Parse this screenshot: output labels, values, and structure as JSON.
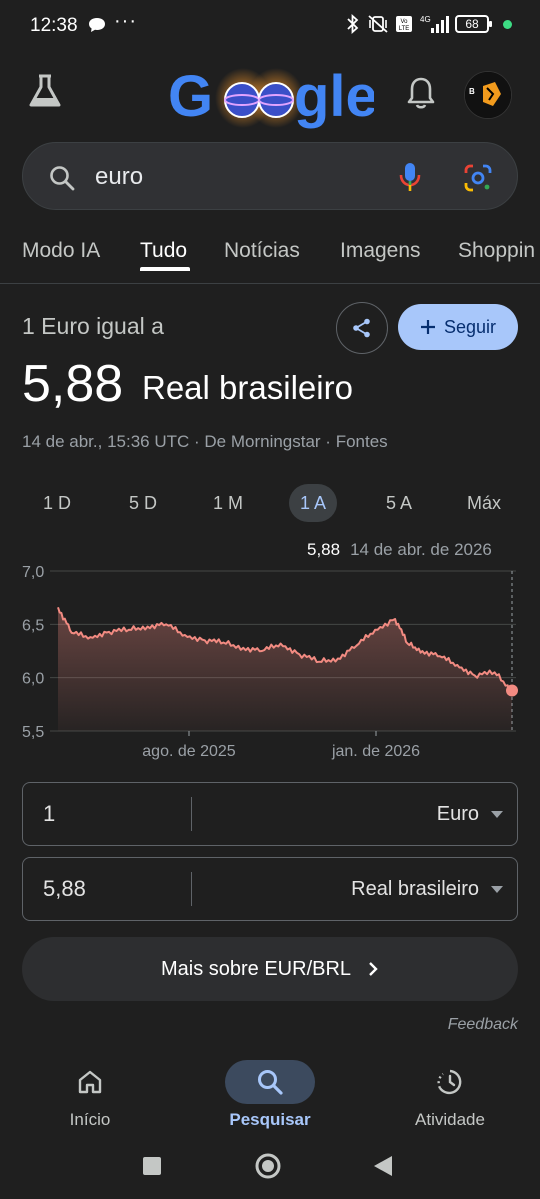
{
  "status_bar": {
    "time": "12:38",
    "battery": "68",
    "network": "4G"
  },
  "header": {
    "logo_text": "Google"
  },
  "search": {
    "query": "euro"
  },
  "tabs": [
    {
      "label": "Modo IA"
    },
    {
      "label": "Tudo"
    },
    {
      "label": "Notícias"
    },
    {
      "label": "Imagens"
    },
    {
      "label": "Shoppin"
    }
  ],
  "conversion": {
    "label": "1 Euro igual a",
    "rate": "5,88",
    "target_currency": "Real brasileiro",
    "meta": "14 de abr., 15:36 UTC · De Morningstar · Fontes",
    "follow_label": "Seguir"
  },
  "ranges": [
    {
      "label": "1 D"
    },
    {
      "label": "5 D"
    },
    {
      "label": "1 M"
    },
    {
      "label": "1 A",
      "active": true
    },
    {
      "label": "5 A"
    },
    {
      "label": "Máx"
    }
  ],
  "tooltip": {
    "value": "5,88",
    "date": "14 de abr. de 2026"
  },
  "chart_data": {
    "type": "area",
    "title": "",
    "xlabel": "",
    "ylabel": "",
    "ylim": [
      5.5,
      7.0
    ],
    "yticks": [
      "7,0",
      "6,5",
      "6,0",
      "5,5"
    ],
    "xticks": [
      "ago. de 2025",
      "jan. de 2026"
    ],
    "series": [
      {
        "color": "#f28b82",
        "x": [
          "2025-04-14",
          "2025-04-25",
          "2025-05-10",
          "2025-05-25",
          "2025-06-10",
          "2025-06-25",
          "2025-07-10",
          "2025-07-25",
          "2025-08-10",
          "2025-08-25",
          "2025-09-10",
          "2025-09-25",
          "2025-10-10",
          "2025-10-25",
          "2025-11-10",
          "2025-11-25",
          "2025-12-10",
          "2025-12-25",
          "2026-01-10",
          "2026-01-20",
          "2026-02-01",
          "2026-02-15",
          "2026-03-01",
          "2026-03-15",
          "2026-03-31",
          "2026-04-14"
        ],
        "values": [
          6.66,
          6.42,
          6.38,
          6.43,
          6.45,
          6.48,
          6.5,
          6.4,
          6.35,
          6.33,
          6.28,
          6.25,
          6.32,
          6.22,
          6.15,
          6.18,
          6.3,
          6.45,
          6.55,
          6.32,
          6.25,
          6.2,
          6.12,
          6.02,
          6.05,
          5.88
        ]
      }
    ]
  },
  "converter": {
    "from_value": "1",
    "from_currency": "Euro",
    "to_value": "5,88",
    "to_currency": "Real brasileiro"
  },
  "more_button": "Mais sobre EUR/BRL",
  "feedback": "Feedback",
  "bottom_nav": [
    {
      "label": "Início"
    },
    {
      "label": "Pesquisar",
      "active": true
    },
    {
      "label": "Atividade"
    }
  ]
}
